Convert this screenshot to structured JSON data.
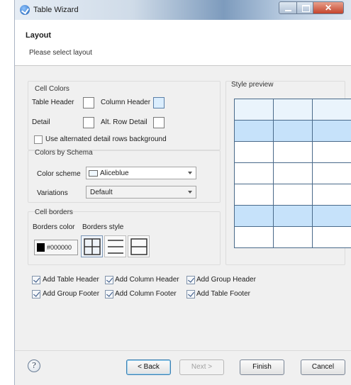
{
  "window": {
    "title": "Table Wizard"
  },
  "header": {
    "title": "Layout",
    "subtitle": "Please select layout"
  },
  "cell_colors": {
    "title": "Cell Colors",
    "table_header_label": "Table Header",
    "column_header_label": "Column Header",
    "detail_label": "Detail",
    "alt_row_detail_label": "Alt. Row Detail",
    "use_alternated_label": "Use alternated detail rows background",
    "use_alternated_checked": false
  },
  "colors_by_schema": {
    "title": "Colors by Schema",
    "color_scheme_label": "Color scheme",
    "color_scheme_value": "Aliceblue",
    "variations_label": "Variations",
    "variations_value": "Default"
  },
  "cell_borders": {
    "title": "Cell borders",
    "borders_color_label": "Borders color",
    "borders_style_label": "Borders style",
    "color_value": "#000000"
  },
  "style_preview": {
    "title": "Style preview"
  },
  "options": [
    {
      "label": "Add Table Header",
      "checked": true
    },
    {
      "label": "Add Column Header",
      "checked": true
    },
    {
      "label": "Add Group Header",
      "checked": true
    },
    {
      "label": "Add Group Footer",
      "checked": true
    },
    {
      "label": "Add Column Footer",
      "checked": true
    },
    {
      "label": "Add Table Footer",
      "checked": true
    }
  ],
  "footer": {
    "help_symbol": "?",
    "back_label": "< Back",
    "next_label": "Next >",
    "finish_label": "Finish",
    "cancel_label": "Cancel"
  },
  "colors": {
    "preview_header": "#eaf4fc",
    "preview_highlight": "#c6e2fa",
    "preview_border": "#4a6a8a"
  }
}
